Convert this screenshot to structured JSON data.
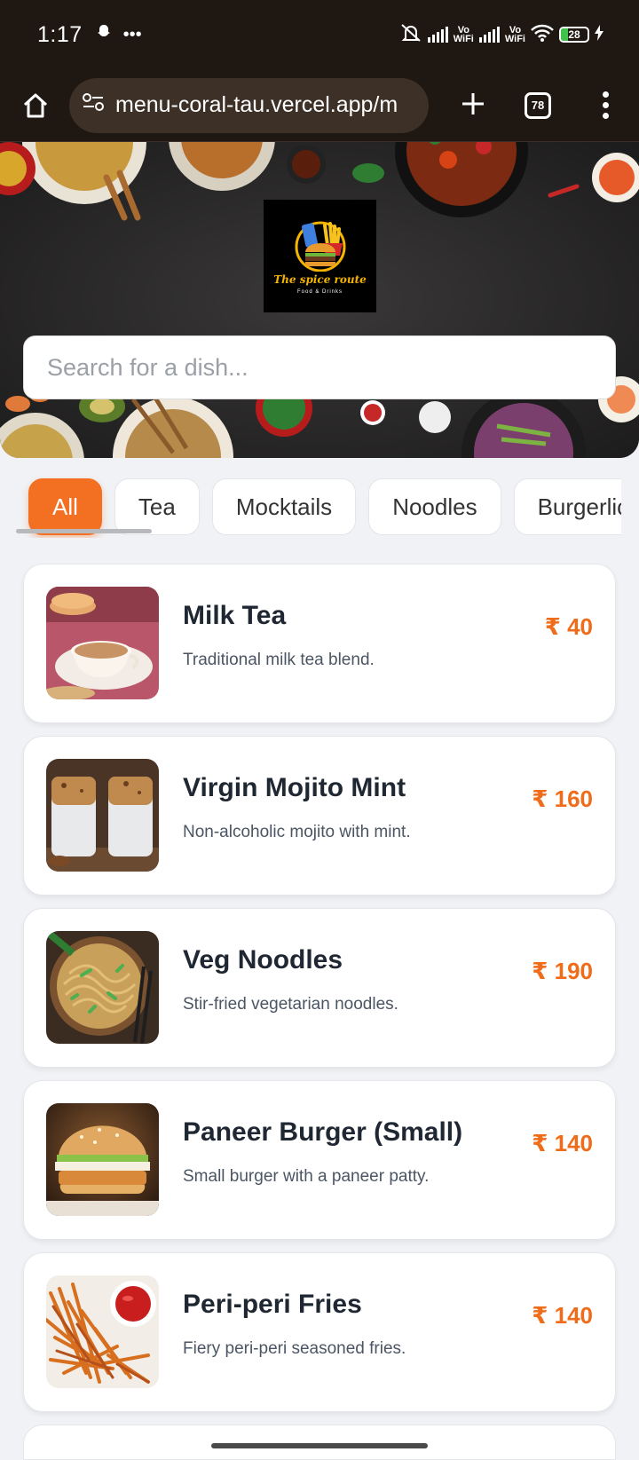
{
  "status_bar": {
    "time": "1:17",
    "left_icons": [
      "snapchat-icon",
      "more-dots-icon"
    ],
    "right_icons": [
      "silent-mode-icon",
      "signal-icon",
      "vowifi-icon",
      "signal-icon",
      "vowifi-icon",
      "wifi-icon",
      "battery-icon",
      "charging-icon"
    ],
    "vowifi_label": "Vo\nWiFi",
    "battery": "28"
  },
  "browser": {
    "url": "menu-coral-tau.vercel.app/m",
    "tab_count": "78"
  },
  "hero": {
    "logo_title": "The spice route",
    "logo_subtitle": "Food & Drinks",
    "search_placeholder": "Search for a dish..."
  },
  "categories": [
    "All",
    "Tea",
    "Mocktails",
    "Noodles",
    "Burgerlicious"
  ],
  "active_category": "All",
  "items": [
    {
      "name": "Milk Tea",
      "description": "Traditional milk tea blend.",
      "price": "₹ 40"
    },
    {
      "name": "Virgin Mojito Mint",
      "description": "Non-alcoholic mojito with mint.",
      "price": "₹ 160"
    },
    {
      "name": "Veg Noodles",
      "description": "Stir-fried vegetarian noodles.",
      "price": "₹ 190"
    },
    {
      "name": "Paneer Burger (Small)",
      "description": "Small burger with a paneer patty.",
      "price": "₹ 140"
    },
    {
      "name": "Peri-peri Fries",
      "description": "Fiery peri-peri seasoned fries.",
      "price": "₹ 140"
    }
  ],
  "colors": {
    "accent": "#f36f21",
    "price": "#ef6c1a",
    "browser_bg": "#1f1712"
  }
}
